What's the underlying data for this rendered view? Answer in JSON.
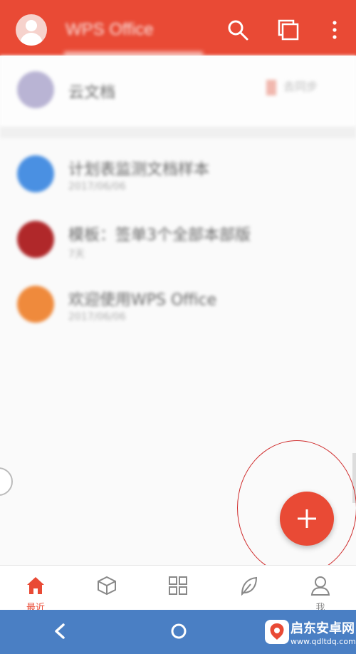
{
  "header": {
    "title": "WPS Office",
    "accent": "#e94a35"
  },
  "icons": {
    "avatar": "user-avatar-icon",
    "search": "search-icon",
    "windows": "windows-icon",
    "more": "more-vert-icon"
  },
  "top_entry": {
    "name": "云文档",
    "action": "去同步"
  },
  "files": [
    {
      "name": "计划表监测文档样本",
      "meta": "2017/06/06",
      "color": "#4a90e2"
    },
    {
      "name": "模板：签单3个全部本部版",
      "meta": "7天",
      "color": "#b0282a"
    },
    {
      "name": "欢迎使用WPS Office",
      "meta": "2017/06/06",
      "color": "#ef8a3c"
    }
  ],
  "bottom_nav": [
    {
      "label": "最近",
      "icon": "home-icon",
      "active": true
    },
    {
      "label": "",
      "icon": "cube-icon",
      "active": false
    },
    {
      "label": "",
      "icon": "apps-grid-icon",
      "active": false
    },
    {
      "label": "",
      "icon": "leaf-icon",
      "active": false
    },
    {
      "label": "我",
      "icon": "person-icon",
      "active": false
    }
  ],
  "fab": {
    "icon": "plus-icon"
  },
  "system_nav": {
    "back": "back-icon",
    "home": "home-circle-icon"
  },
  "watermark": {
    "name": "启东安卓网",
    "url": "www.qdltdq.com"
  }
}
